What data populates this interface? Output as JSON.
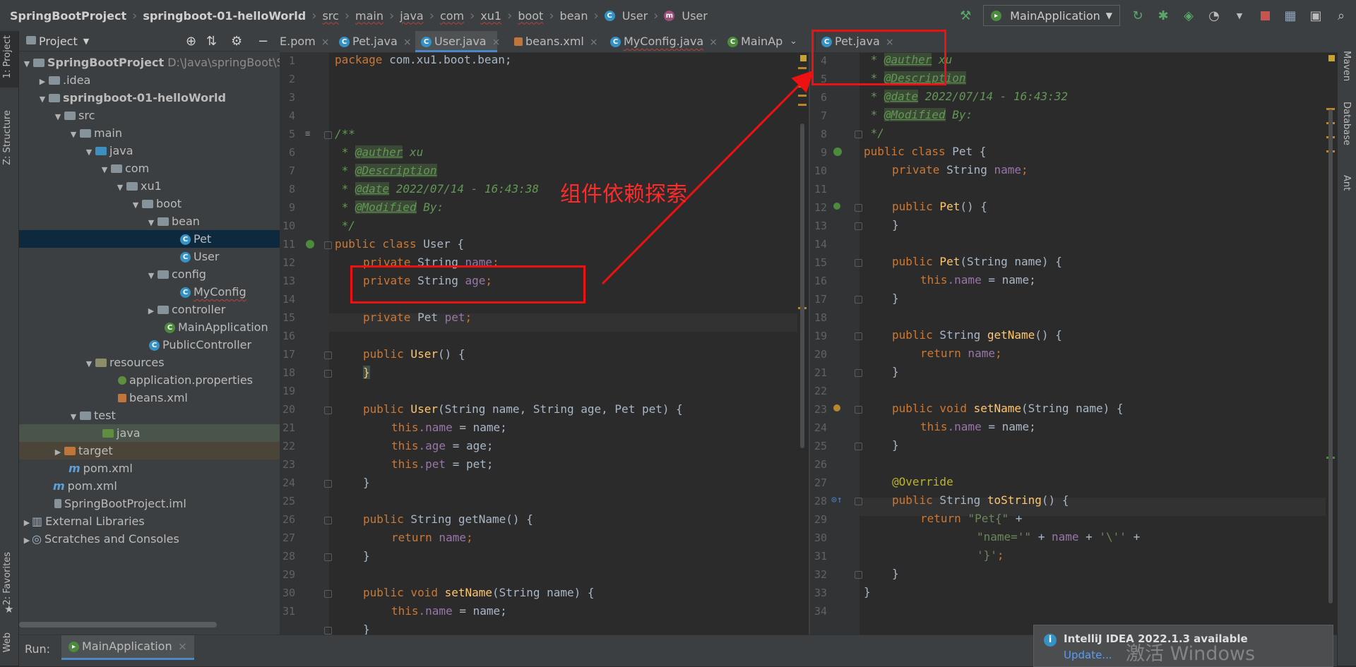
{
  "breadcrumbs": [
    "SpringBootProject",
    "springboot-01-helloWorld",
    "src",
    "main",
    "java",
    "com",
    "xu1",
    "boot",
    "bean",
    "User",
    "User"
  ],
  "run_config": "MainApplication",
  "left_stripe": {
    "project": "1: Project",
    "structure": "Z: Structure",
    "favorites": "2: Favorites",
    "web": "Web"
  },
  "right_stripe": {
    "maven": "Maven",
    "database": "Database",
    "ant": "Ant"
  },
  "project_panel": {
    "title": "Project",
    "root_label": "SpringBootProject",
    "root_path": "D:\\Java\\springBoot\\Spri",
    "items": [
      ".idea",
      "springboot-01-helloWorld",
      "src",
      "main",
      "java",
      "com",
      "xu1",
      "boot",
      "bean",
      "Pet",
      "User",
      "config",
      "MyConfig",
      "controller",
      "MainApplication",
      "PublicController",
      "resources",
      "application.properties",
      "beans.xml",
      "test",
      "java",
      "target",
      "pom.xml",
      "pom.xml",
      "SpringBootProject.iml",
      "External Libraries",
      "Scratches and Consoles"
    ]
  },
  "tabs": [
    "E.pom",
    "Pet.java",
    "User.java",
    "beans.xml",
    "MyConfig.java",
    "MainAp",
    "Pet.java"
  ],
  "left_editor": {
    "line_numbers": [
      "1",
      "2",
      "3",
      "4",
      "5",
      "6",
      "7",
      "8",
      "9",
      "10",
      "11",
      "12",
      "13",
      "14",
      "15",
      "16",
      "17",
      "18",
      "19",
      "20",
      "21",
      "22",
      "23",
      "24",
      "25",
      "26",
      "27",
      "28",
      "29",
      "30",
      "31"
    ],
    "lines": {
      "l1_kw": "package",
      "l1_rest": " com.xu1.boot.bean;",
      "l3": "/**",
      "l4_tag": "@auther",
      "l4_rest": " xu",
      "l5_tag": "@Description",
      "l6_tag": "@date",
      "l6_rest": " 2022/07/14 - 16:43:38",
      "l7_tag": "@Modified",
      "l7_rest": " By:",
      "l8": " */",
      "l9_kw": "public class",
      "l9_rest": " User {",
      "l10_kw": "private",
      "l10_type": " String ",
      "l10_fld": "name",
      "l10_end": ";",
      "l11_kw": "private",
      "l11_type": " String ",
      "l11_fld": "age",
      "l11_end": ";",
      "l13_kw": "private",
      "l13_type": " Pet ",
      "l13_fld": "pet",
      "l13_end": ";",
      "l15_kw": "public",
      "l15_fn": " User",
      "l15_rest": "() {",
      "l16": "}",
      "l18_kw": "public",
      "l18_fn": " User",
      "l18_rest": "(String name, String age, Pet pet) {",
      "l19_kw": "this",
      "l19_fld": ".name",
      "l19_rest": " = name;",
      "l20_kw": "this",
      "l20_fld": ".age",
      "l20_rest": " = age;",
      "l21_kw": "this",
      "l21_fld": ".pet",
      "l21_rest": " = pet;",
      "l22": "}",
      "l24_kw": "public",
      "l24_type": " String ",
      "l24_fn": "getName",
      "l24_rest": "() {",
      "l25_kw": "return",
      "l25_fld": " name",
      "l25_end": ";",
      "l26": "}",
      "l28_kw": "public void",
      "l28_fn": " setName",
      "l28_rest": "(String name) {",
      "l29_kw": "this",
      "l29_fld": ".name",
      "l29_rest": " = name;",
      "l30": "}"
    }
  },
  "right_editor": {
    "line_numbers": [
      "4",
      "5",
      "6",
      "7",
      "8",
      "9",
      "10",
      "11",
      "12",
      "13",
      "14",
      "15",
      "16",
      "17",
      "18",
      "19",
      "20",
      "21",
      "22",
      "23",
      "24",
      "25",
      "26",
      "27",
      "28",
      "29",
      "30",
      "31",
      "32",
      "33",
      "34"
    ],
    "lines": {
      "r4_tag": "@auther",
      "r4_rest": " xu",
      "r5_tag": "@Description",
      "r6_tag": "@date",
      "r6_rest": " 2022/07/14 - 16:43:32",
      "r7_tag": "@Modified",
      "r7_rest": " By:",
      "r8": " */",
      "r9_kw": "public class",
      "r9_rest": " Pet {",
      "r10_kw": "private",
      "r10_type": " String ",
      "r10_fld": "name",
      "r10_end": ";",
      "r12_kw": "public",
      "r12_fn": " Pet",
      "r12_rest": "() {",
      "r13": "}",
      "r15_kw": "public",
      "r15_fn": " Pet",
      "r15_rest": "(String name) {",
      "r16_kw": "this",
      "r16_fld": ".name",
      "r16_rest": " = name;",
      "r17": "}",
      "r19_kw": "public",
      "r19_type": " String ",
      "r19_fn": "getName",
      "r19_rest": "() {",
      "r20_kw": "return",
      "r20_fld": " name",
      "r20_end": ";",
      "r21": "}",
      "r23_kw": "public void",
      "r23_fn": " setName",
      "r23_rest": "(String name) {",
      "r24_kw": "this",
      "r24_fld": ".name",
      "r24_rest": " = name;",
      "r25": "}",
      "r27_ann": "@Override",
      "r28_kw": "public",
      "r28_type": " String ",
      "r28_fn": "toString",
      "r28_rest": "() {",
      "r29_kw": "return",
      "r29_str": " \"Pet{\"",
      "r29_rest": " +",
      "r30_str": "\"name='\"",
      "r30_mid": " + ",
      "r30_fld": "name",
      "r30_mid2": " + ",
      "r30_str2": "'\\''",
      "r30_rest": " +",
      "r31_str": "'}'",
      "r31_rest": ";",
      "r32": "}",
      "r33": "}"
    }
  },
  "annotation_label": "组件依赖探索",
  "run_bar": {
    "label": "Run:",
    "tab": "MainApplication"
  },
  "notification": {
    "title": "IntelliJ IDEA 2022.1.3 available",
    "link": "Update..."
  },
  "watermark": "激活 Windows",
  "colors": {
    "keyword": "#cc7832",
    "comment_tag": "#629755",
    "field": "#9876aa",
    "function": "#ffc66d",
    "annotation_box": "#ee1111",
    "selection": "#0d293e"
  }
}
